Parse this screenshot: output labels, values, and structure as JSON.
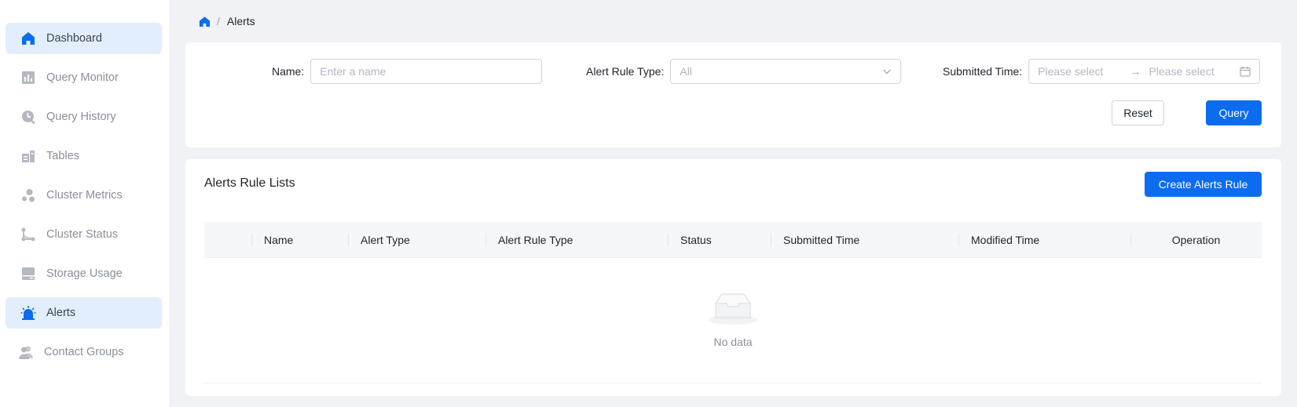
{
  "sidebar": {
    "items": [
      {
        "label": "Dashboard",
        "icon": "home-icon",
        "active": true
      },
      {
        "label": "Query Monitor",
        "icon": "bar-chart-icon",
        "active": false
      },
      {
        "label": "Query History",
        "icon": "history-clock-icon",
        "active": false
      },
      {
        "label": "Tables",
        "icon": "tables-icon",
        "active": false
      },
      {
        "label": "Cluster Metrics",
        "icon": "cluster-metrics-icon",
        "active": false
      },
      {
        "label": "Cluster Status",
        "icon": "cluster-status-icon",
        "active": false
      },
      {
        "label": "Storage Usage",
        "icon": "storage-icon",
        "active": false
      },
      {
        "label": "Alerts",
        "icon": "alarm-icon",
        "active": true
      },
      {
        "label": "Contact Groups",
        "icon": "contact-groups-icon",
        "active": false
      }
    ]
  },
  "breadcrumb": {
    "separator": "/",
    "current": "Alerts"
  },
  "filters": {
    "name_label": "Name",
    "name_placeholder": "Enter a name",
    "rule_type_label": "Alert Rule Type",
    "rule_type_value": "All",
    "submitted_time_label": "Submitted Time",
    "start_placeholder": "Please select",
    "end_placeholder": "Please select",
    "reset_label": "Reset",
    "query_label": "Query"
  },
  "list": {
    "title": "Alerts Rule Lists",
    "create_label": "Create Alerts Rule",
    "columns": [
      "",
      "Name",
      "Alert Type",
      "Alert Rule Type",
      "Status",
      "Submitted Time",
      "Modified Time",
      "Operation"
    ],
    "empty_text": "No data"
  },
  "colors": {
    "primary": "#0b6cf0",
    "active_bg": "#e3eefd",
    "page_bg": "#f0f2f5"
  }
}
